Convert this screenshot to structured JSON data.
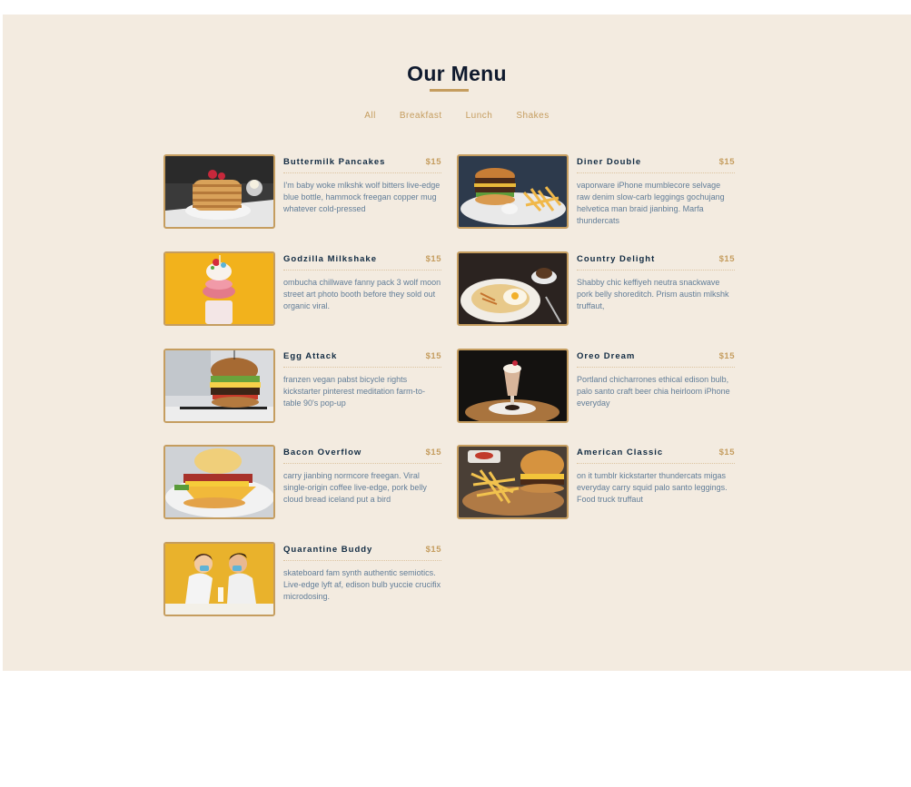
{
  "page": {
    "title": "Our Menu"
  },
  "filters": [
    {
      "label": "All"
    },
    {
      "label": "Breakfast"
    },
    {
      "label": "Lunch"
    },
    {
      "label": "Shakes"
    }
  ],
  "menu": [
    {
      "name": "Buttermilk Pancakes",
      "price": "$15",
      "desc": "I'm baby woke mlkshk wolf bitters live-edge blue bottle, hammock freegan copper mug whatever cold-pressed",
      "image": "pancakes"
    },
    {
      "name": "Diner Double",
      "price": "$15",
      "desc": "vaporware iPhone mumblecore selvage raw denim slow-carb leggings gochujang helvetica man braid jianbing. Marfa thundercats",
      "image": "burger-fries"
    },
    {
      "name": "Godzilla Milkshake",
      "price": "$15",
      "desc": "ombucha chillwave fanny pack 3 wolf moon street art photo booth before they sold out organic viral.",
      "image": "milkshake-yellow"
    },
    {
      "name": "Country Delight",
      "price": "$15",
      "desc": "Shabby chic keffiyeh neutra snackwave pork belly shoreditch. Prism austin mlkshk truffaut,",
      "image": "breakfast-plate"
    },
    {
      "name": "Egg Attack",
      "price": "$15",
      "desc": "franzen vegan pabst bicycle rights kickstarter pinterest meditation farm-to-table 90's pop-up",
      "image": "egg-burger"
    },
    {
      "name": "Oreo Dream",
      "price": "$15",
      "desc": "Portland chicharrones ethical edison bulb, palo santo craft beer chia heirloom iPhone everyday",
      "image": "oreo-shake"
    },
    {
      "name": "Bacon Overflow",
      "price": "$15",
      "desc": "carry jianbing normcore freegan. Viral single-origin coffee live-edge, pork belly cloud bread iceland put a bird",
      "image": "bacon-burger"
    },
    {
      "name": "American Classic",
      "price": "$15",
      "desc": "on it tumblr kickstarter thundercats migas everyday carry squid palo santo leggings. Food truck truffaut",
      "image": "classic-burger"
    },
    {
      "name": "Quarantine Buddy",
      "price": "$15",
      "desc": "skateboard fam synth authentic semiotics. Live-edge lyft af, edison bulb yuccie crucifix microdosing.",
      "image": "couple-masks"
    }
  ]
}
